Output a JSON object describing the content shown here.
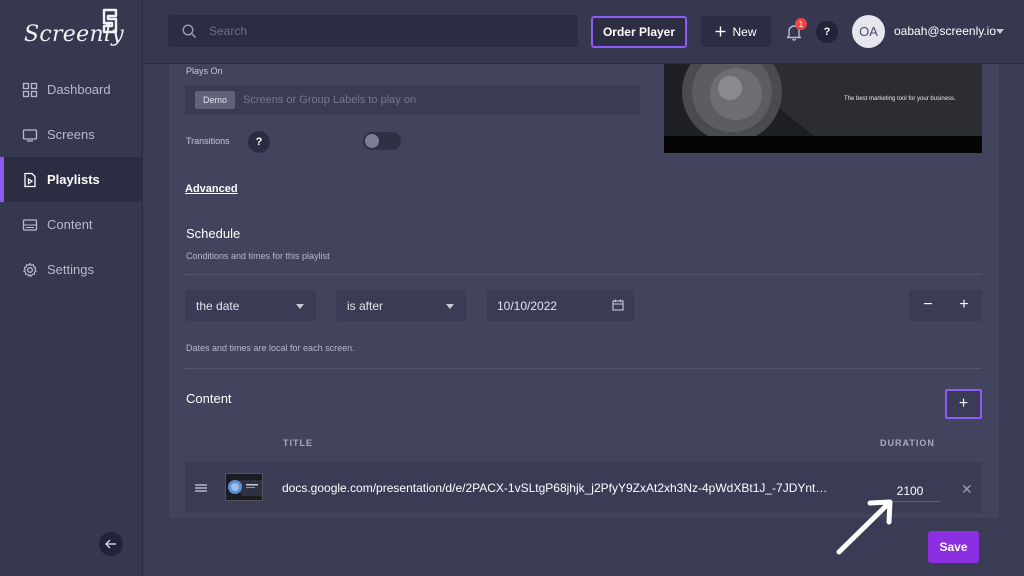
{
  "app": {
    "logo_text": "Screenly"
  },
  "sidebar": {
    "items": [
      {
        "label": "Dashboard",
        "icon": "grid-icon",
        "active": false
      },
      {
        "label": "Screens",
        "icon": "monitor-icon",
        "active": false
      },
      {
        "label": "Playlists",
        "icon": "playlist-icon",
        "active": true
      },
      {
        "label": "Content",
        "icon": "image-icon",
        "active": false
      },
      {
        "label": "Settings",
        "icon": "gear-icon",
        "active": false
      }
    ]
  },
  "topbar": {
    "search_placeholder": "Search",
    "order_player_label": "Order Player",
    "new_label": "New",
    "notification_count": "1",
    "help_label": "?",
    "avatar_initials": "OA",
    "user_email": "oabah@screenly.io"
  },
  "playlist": {
    "plays_on_label": "Plays On",
    "plays_on_chip": "Demo",
    "plays_on_placeholder": "Screens or Group Labels to play on",
    "transitions_label": "Transitions",
    "transitions_help": "?",
    "transitions_enabled": false,
    "preview_caption": "The best marketing tool for your business.",
    "advanced_label": "Advanced"
  },
  "schedule": {
    "title": "Schedule",
    "subtitle": "Conditions and times for this playlist",
    "condition_field": "the date",
    "condition_operator": "is after",
    "condition_value": "10/10/2022",
    "minus_label": "−",
    "plus_label": "+",
    "note": "Dates and times are local for each screen."
  },
  "content": {
    "title": "Content",
    "add_label": "+",
    "columns": {
      "title": "TITLE",
      "duration": "DURATION"
    },
    "rows": [
      {
        "title": "docs.google.com/presentation/d/e/2PACX-1vSLtgP68jhjk_j2PfyY9ZxAt2xh3Nz-4pWdXBt1J_-7JDYnt…",
        "duration": "2100"
      }
    ]
  },
  "footer": {
    "save_label": "Save"
  },
  "colors": {
    "accent": "#8b5cf6",
    "save": "#8b2fe0",
    "badge": "#ef4444"
  }
}
